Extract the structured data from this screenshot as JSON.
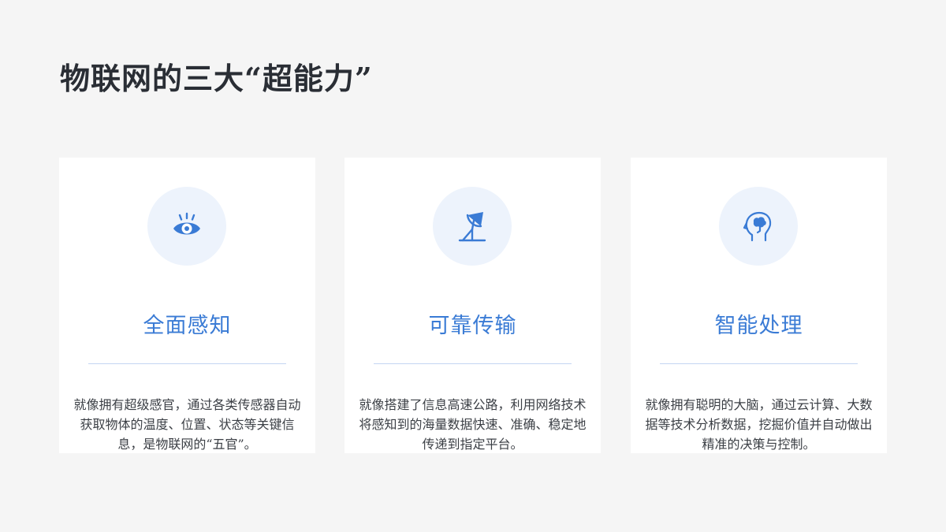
{
  "page": {
    "title": "物联网的三大“超能力”"
  },
  "colors": {
    "accent": "#3a7bd5",
    "icon_bg": "#edf3fc",
    "divider": "#c4d6f2",
    "card_bg": "#ffffff",
    "page_bg": "#f5f5f5"
  },
  "cards": [
    {
      "icon": "eye-icon",
      "title": "全面感知",
      "description": "就像拥有超级感官，通过各类传感器自动获取物体的温度、位置、状态等关键信息，是物联网的“五官”。"
    },
    {
      "icon": "satellite-dish-icon",
      "title": "可靠传输",
      "description": "就像搭建了信息高速公路，利用网络技术将感知到的海量数据快速、准确、稳定地传递到指定平台。"
    },
    {
      "icon": "brain-head-icon",
      "title": "智能处理",
      "description": "就像拥有聪明的大脑，通过云计算、大数据等技术分析数据，挖掘价值并自动做出精准的决策与控制。"
    }
  ]
}
